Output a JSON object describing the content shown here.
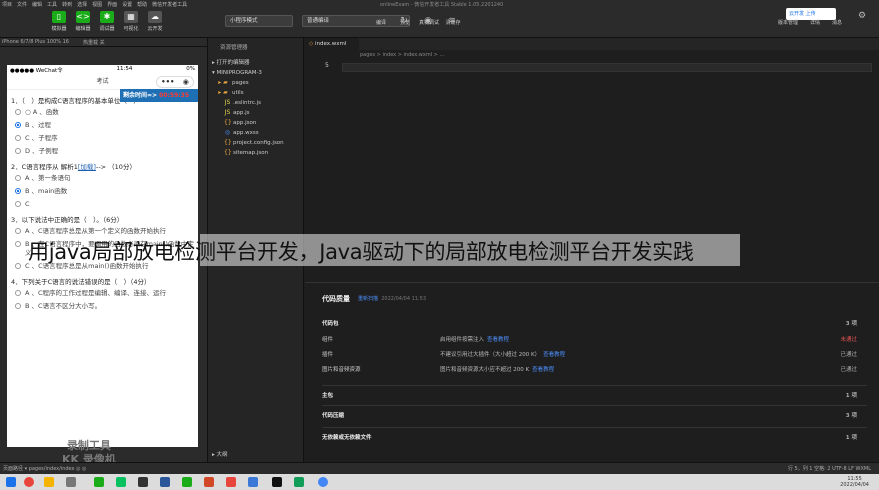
{
  "titlebar": {
    "menu": [
      "项目",
      "文件",
      "编辑",
      "工具",
      "转到",
      "选择",
      "视图",
      "界面",
      "设置",
      "帮助",
      "微信开发者工具"
    ],
    "window_title": "onlineExam - 微信开发者工具 Stable 1.05.2201240"
  },
  "toolbar": {
    "buttons_left": [
      "模拟器",
      "编辑器",
      "调试器",
      "可视化",
      "云开发"
    ],
    "mode_select": "小程序模式",
    "compile_select": "普通编译",
    "buttons_mid": [
      "编译",
      "预览",
      "真机调试",
      "清缓存"
    ],
    "buttons_right": [
      "版本管理",
      "详情",
      "消息"
    ],
    "cloud_label": "云开发 上传"
  },
  "simulator": {
    "device": "iPhone 6/7/8 Plus 100% 16",
    "hotreload": "热重载 关",
    "status_left": "●●●●● WeChat令",
    "status_time": "11:54",
    "status_right": "0%",
    "nav_title": "考试",
    "timer_label": "剩余时间=>",
    "timer_value": "00:59:35",
    "watermark_line1": "录制工具",
    "watermark_line2": "KK 录像机",
    "questions": [
      {
        "stem": "1．（　）是构成C语言程序的基本单位（　）",
        "options": [
          {
            "label": "○ A 、函数",
            "checked": false
          },
          {
            "label": "B 、过程",
            "checked": true
          },
          {
            "label": "C 、子程序",
            "checked": false
          },
          {
            "label": "D 、子例程",
            "checked": false
          }
        ]
      },
      {
        "stem": "2．C语言程序从 解析1",
        "link": "[加载]",
        "stem_tail": "--> （10分）",
        "options": [
          {
            "label": "A 、第一条语句",
            "checked": false
          },
          {
            "label": "B 、main函数",
            "checked": true
          },
          {
            "label": "C",
            "checked": false
          }
        ]
      },
      {
        "stem": "3．以下说法中正确的是（　）。（6分）",
        "options": [
          {
            "label": "A 、C语言程序总是从第一个定义的函数开始执行",
            "checked": false
          },
          {
            "label": "B 、在C语言程序中，要调用的函数必须在main()函数中定义",
            "checked": false
          },
          {
            "label": "C 、C语言程序总是从main()函数开始执行",
            "checked": false
          }
        ]
      },
      {
        "stem": "4．下列关于C语言的说法错误的是（　）（4分）",
        "options": [
          {
            "label": "A 、C程序的工作过程是编辑、编译、连接、运行",
            "checked": false
          },
          {
            "label": "B 、C语言不区分大小写。",
            "checked": false
          }
        ]
      }
    ]
  },
  "explorer": {
    "header": "资源管理器",
    "sections": [
      "▸ 打开的编辑器",
      "▾ MINIPROGRAM-3"
    ],
    "files": [
      {
        "name": "pages",
        "type": "folder"
      },
      {
        "name": "utils",
        "type": "folder"
      },
      {
        "name": ".eslintrc.js",
        "type": "js"
      },
      {
        "name": "app.js",
        "type": "js"
      },
      {
        "name": "app.json",
        "type": "json"
      },
      {
        "name": "app.wxss",
        "type": "wxss"
      },
      {
        "name": "project.config.json",
        "type": "json"
      },
      {
        "name": "sitemap.json",
        "type": "json"
      }
    ],
    "footer": "▸ 大纲"
  },
  "editor": {
    "tab": "index.wxml",
    "breadcrumb": "pages > index > index.wxml > ...",
    "line_number": "5"
  },
  "caption": "用java局部放电检测平台开发，Java驱动下的局部放电检测平台开发实践",
  "quality": {
    "title": "代码质量",
    "subtitle_link": "重新扫描",
    "subtitle_time": "2022/04/04 11:53",
    "rows": [
      {
        "type": "section",
        "label": "代码包",
        "status": "3 项"
      },
      {
        "type": "item",
        "label": "组件",
        "desc": "启用组件按需注入",
        "more": "查看教程",
        "status": "未通过",
        "status_class": "bad"
      },
      {
        "type": "item",
        "label": "插件",
        "desc": "不建议引用过大插件（大小超过 200 K）",
        "more": "查看教程",
        "status": "已通过",
        "status_class": "ok"
      },
      {
        "type": "item",
        "label": "图片和音频资源",
        "desc": "图片和音频资源大小应不超过 200 K",
        "more": "查看教程",
        "status": "已通过",
        "status_class": "ok"
      },
      {
        "type": "section",
        "label": "主包",
        "status": "1 项"
      },
      {
        "type": "section",
        "label": "代码压缩",
        "status": "3 项"
      },
      {
        "type": "section",
        "label": "无依赖或无依赖文件",
        "status": "1 项"
      }
    ]
  },
  "statusbar": {
    "left": "页面路径 ▾  pages/index/index  ◎ ◎",
    "right": "行 5，列 1   空格: 2   UTF-8   LF   WXML"
  },
  "taskbar": {
    "time": "11:55",
    "date": "2022/04/04"
  },
  "colors": {
    "accent_green": "#1aad19",
    "timer_bg": "#1f6fb5",
    "link_blue": "#4d90fe",
    "fail_red": "#e05252"
  }
}
